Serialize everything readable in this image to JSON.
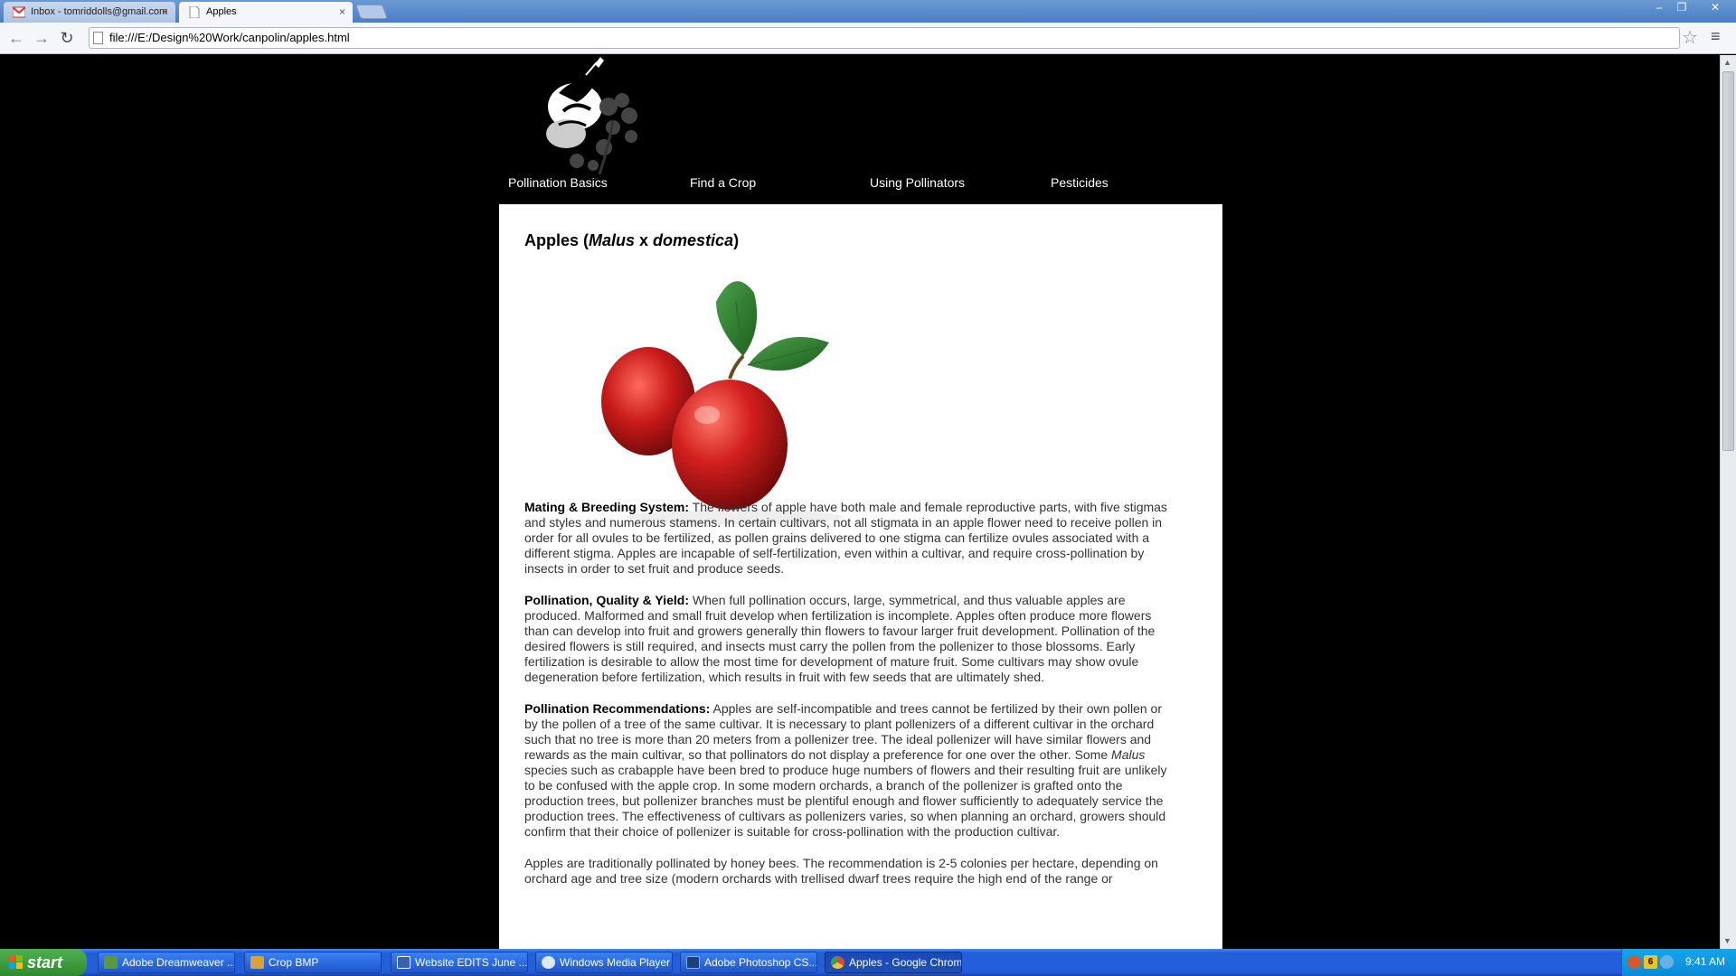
{
  "tabs": [
    {
      "title": "Inbox - tomriddolls@gmail.com",
      "active": false
    },
    {
      "title": "Apples",
      "active": true
    }
  ],
  "address": {
    "url": "file:///E:/Design%20Work/canpolin/apples.html"
  },
  "site": {
    "nav": [
      "Pollination Basics",
      "Find a Crop",
      "Using Pollinators",
      "Pesticides"
    ],
    "heading_prefix": "Apples (",
    "heading_genus": "Malus",
    "heading_x": " x ",
    "heading_species": "domestica",
    "heading_suffix": ")",
    "sections": [
      {
        "label": "Mating & Breeding System:",
        "text": " The flowers of apple have both male and female reproductive parts, with five stigmas and styles and numerous stamens. In certain cultivars, not all stigmata in an apple flower need to receive pollen in order for all ovules to be fertilized, as pollen grains delivered to one stigma can fertilize ovules associated with a different stigma. Apples are incapable of self-fertilization, even within a cultivar, and require cross-pollination by insects in order to set fruit and produce seeds."
      },
      {
        "label": "Pollination, Quality & Yield:",
        "text": " When full pollination occurs, large, symmetrical, and thus valuable apples are produced. Malformed and small fruit develop when fertilization is incomplete. Apples often produce more flowers than can develop into fruit and growers generally thin flowers to favour larger fruit development. Pollination of the desired flowers is still required, and insects must carry the pollen from the pollenizer to those blossoms. Early fertilization is desirable to allow the most time for development of mature fruit. Some cultivars may show ovule degeneration before fertilization, which results in fruit with few seeds that are ultimately shed."
      },
      {
        "label": "Pollination Recommendations:",
        "text_a": " Apples are self-incompatible and trees cannot be fertilized by their own pollen or by the pollen of a tree of the same cultivar. It is necessary to plant pollenizers of a different cultivar in the orchard such that no tree is more than 20 meters from a pollenizer tree. The ideal pollenizer will have similar flowers and rewards as the main cultivar, so that pollinators do not display a preference for one over the other. Some ",
        "italic": "Malus",
        "text_b": " species such as crabapple have been bred to produce huge numbers of flowers and their resulting fruit are unlikely to be confused with the apple crop. In some modern orchards, a branch of the pollenizer is grafted onto the production trees, but pollenizer branches must be plentiful enough and flower sufficiently to adequately service the production trees. The effectiveness of cultivars as pollenizers varies, so when planning an orchard, growers should confirm that their choice of pollenizer is suitable for cross-pollination with the production cultivar."
      },
      {
        "text": "Apples are traditionally pollinated by honey bees. The recommendation is 2-5 colonies per hectare, depending on orchard age and tree size (modern orchards with trellised dwarf trees require the high end of the range or"
      }
    ]
  },
  "taskbar": {
    "start": "start",
    "tasks": [
      {
        "label": "Adobe Dreamweaver ...",
        "icon": "dreamweaver-icon",
        "color": "#5a9a3a"
      },
      {
        "label": "Crop BMP",
        "icon": "paint-icon",
        "color": "#d9a23a"
      },
      {
        "label": "Website EDITS June ...",
        "icon": "word-icon",
        "color": "#3a5fb0"
      },
      {
        "label": "Windows Media Player",
        "icon": "media-player-icon",
        "color": "#e0e6f2"
      },
      {
        "label": "Adobe Photoshop CS...",
        "icon": "photoshop-icon",
        "color": "#1f3f7a"
      },
      {
        "label": "Apples - Google Chrome",
        "icon": "chrome-icon",
        "color": "#e0473a",
        "active": true
      }
    ],
    "tray_count": "6",
    "clock": "9:41 AM"
  }
}
